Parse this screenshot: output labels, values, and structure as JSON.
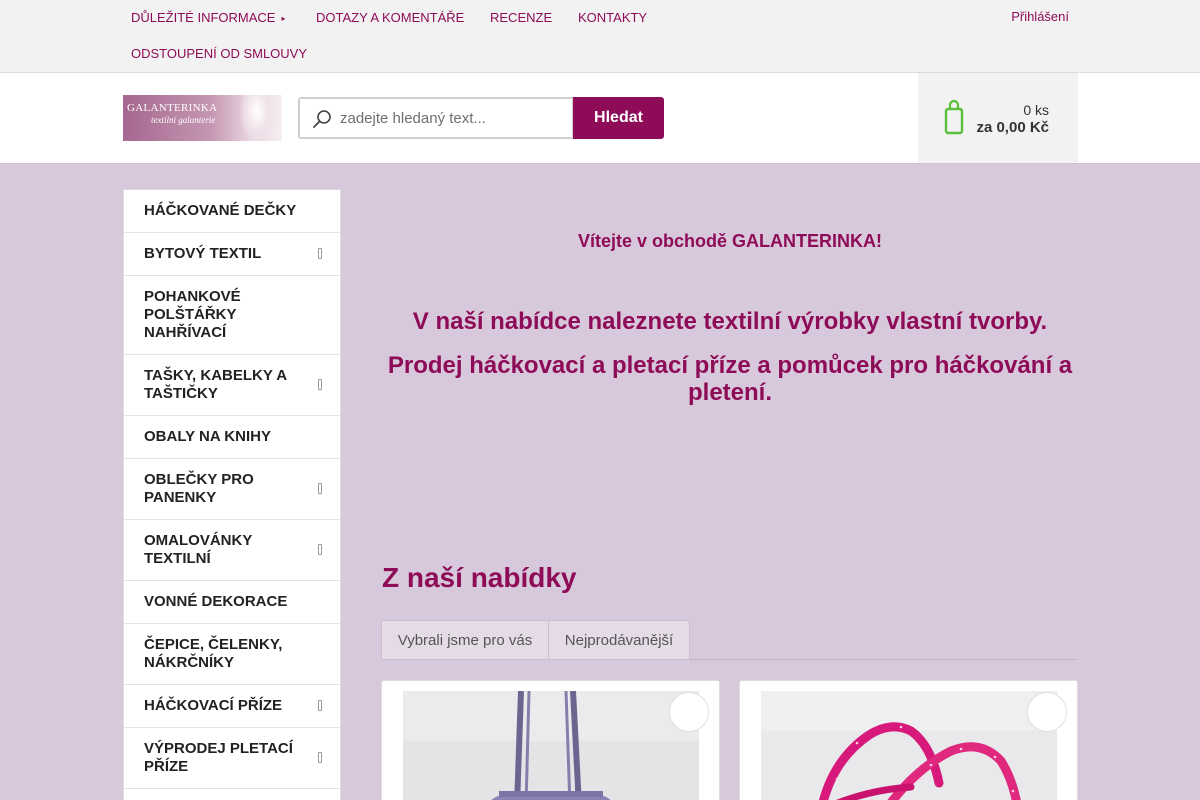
{
  "topnav": {
    "items": [
      {
        "label": "Důležité informace",
        "has_dropdown": true
      },
      {
        "label": "Dotazy a komentáře"
      },
      {
        "label": "Recenze"
      },
      {
        "label": "Kontakty"
      },
      {
        "label": "Odstoupení od smlouvy"
      }
    ],
    "dropdown_caret": "▸",
    "login_label": "Přihlášení",
    "lang_icon": "",
    "user_icon": ""
  },
  "header": {
    "logo_title": "GALANTERINKA",
    "logo_subtitle": "textilní galanterie",
    "search_placeholder": "zadejte hledaný text...",
    "search_button": "Hledat",
    "cart_count": "0 ks",
    "cart_total": "za 0,00 Kč"
  },
  "sidebar": {
    "categories": [
      {
        "label": "HÁČKOVANÉ DEČKY",
        "submenu": false
      },
      {
        "label": "BYTOVÝ TEXTIL",
        "submenu": true
      },
      {
        "label": "POHANKOVÉ POLŠTÁŘKY NAHŘÍVACÍ",
        "submenu": false
      },
      {
        "label": "TAŠKY, KABELKY A TAŠTIČKY",
        "submenu": true
      },
      {
        "label": "OBALY NA KNIHY",
        "submenu": false
      },
      {
        "label": "OBLEČKY PRO PANENKY",
        "submenu": true
      },
      {
        "label": "OMALOVÁNKY TEXTILNÍ",
        "submenu": true
      },
      {
        "label": "VONNÉ DEKORACE",
        "submenu": false
      },
      {
        "label": "ČEPICE, ČELENKY, NÁKRČNÍKY",
        "submenu": false
      },
      {
        "label": "HÁČKOVACÍ PŘÍZE",
        "submenu": true
      },
      {
        "label": "VÝPRODEJ PLETACÍ PŘÍZE",
        "submenu": true
      }
    ]
  },
  "main": {
    "welcome": "Vítejte v obchodě GALANTERINKA!",
    "intro_line1": "V naší nabídce naleznete textilní výrobky vlastní tvorby.",
    "intro_line2": "Prodej háčkovací a pletací příze a pomůcek pro háčkování a pletení.",
    "section_title": "Z naší nabídky",
    "tabs": [
      {
        "label": "Vybrali jsme pro vás"
      },
      {
        "label": "Nejprodávanější"
      }
    ],
    "products": [
      {
        "image": "purple-tote-bag-photo",
        "wish_icon": ""
      },
      {
        "image": "pink-bag-straps-photo",
        "wish_icon": ""
      }
    ]
  },
  "colors": {
    "brand": "#8e0c57",
    "page_background": "#d8c8dc",
    "cart_icon": "#5bbf3a"
  }
}
